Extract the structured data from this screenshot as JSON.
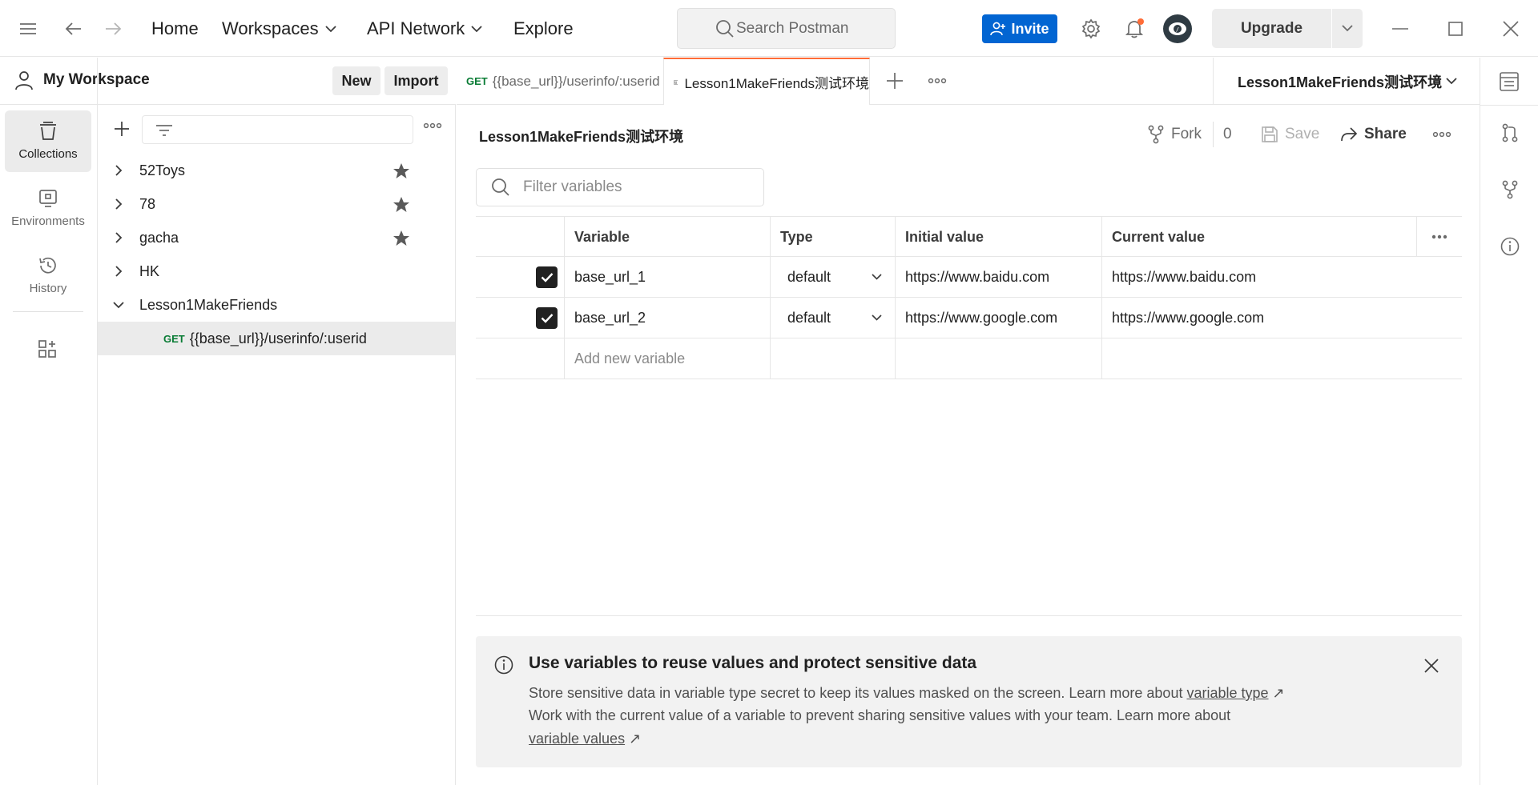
{
  "topbar": {
    "nav": [
      "Home",
      "Workspaces",
      "API Network",
      "Explore"
    ],
    "search_placeholder": "Search Postman",
    "invite_label": "Invite",
    "upgrade_label": "Upgrade"
  },
  "workspace": {
    "name": "My Workspace",
    "new_label": "New",
    "import_label": "Import"
  },
  "rail": {
    "collections": "Collections",
    "environments": "Environments",
    "history": "History"
  },
  "sidebar": {
    "items": [
      {
        "label": "52Toys",
        "starred": true
      },
      {
        "label": "78",
        "starred": true
      },
      {
        "label": "gacha",
        "starred": true
      },
      {
        "label": "HK",
        "starred": false
      },
      {
        "label": "Lesson1MakeFriends",
        "expanded": true
      }
    ],
    "request": {
      "method": "GET",
      "label": "{{base_url}}/userinfo/:userid"
    }
  },
  "tabs": {
    "tab1_method": "GET",
    "tab1_label": "{{base_url}}/userinfo/:userid",
    "tab2_label": "Lesson1MakeFriends测试环境",
    "env_selector": "Lesson1MakeFriends测试环境"
  },
  "main": {
    "title": "Lesson1MakeFriends测试环境",
    "fork_label": "Fork",
    "fork_count": "0",
    "save_label": "Save",
    "share_label": "Share",
    "filter_placeholder": "Filter variables",
    "columns": {
      "variable": "Variable",
      "type": "Type",
      "initial": "Initial value",
      "current": "Current value"
    },
    "rows": [
      {
        "variable": "base_url_1",
        "type": "default",
        "initial": "https://www.baidu.com",
        "current": "https://www.baidu.com",
        "checked": true
      },
      {
        "variable": "base_url_2",
        "type": "default",
        "initial": "https://www.google.com",
        "current": "https://www.google.com",
        "checked": true
      }
    ],
    "add_placeholder": "Add new variable"
  },
  "banner": {
    "title": "Use variables to reuse values and protect sensitive data",
    "line1": "Store sensitive data in variable type secret to keep its values masked on the screen. Learn more about",
    "link1": "variable type",
    "line2": "Work with the current value of a variable to prevent sharing sensitive values with your team. Learn more about",
    "link2": "variable values"
  },
  "colors": {
    "accent": "#ff6c37",
    "invite": "#0265d2",
    "get_method": "#0a7c35",
    "notification_dot": "#ff6c37"
  }
}
